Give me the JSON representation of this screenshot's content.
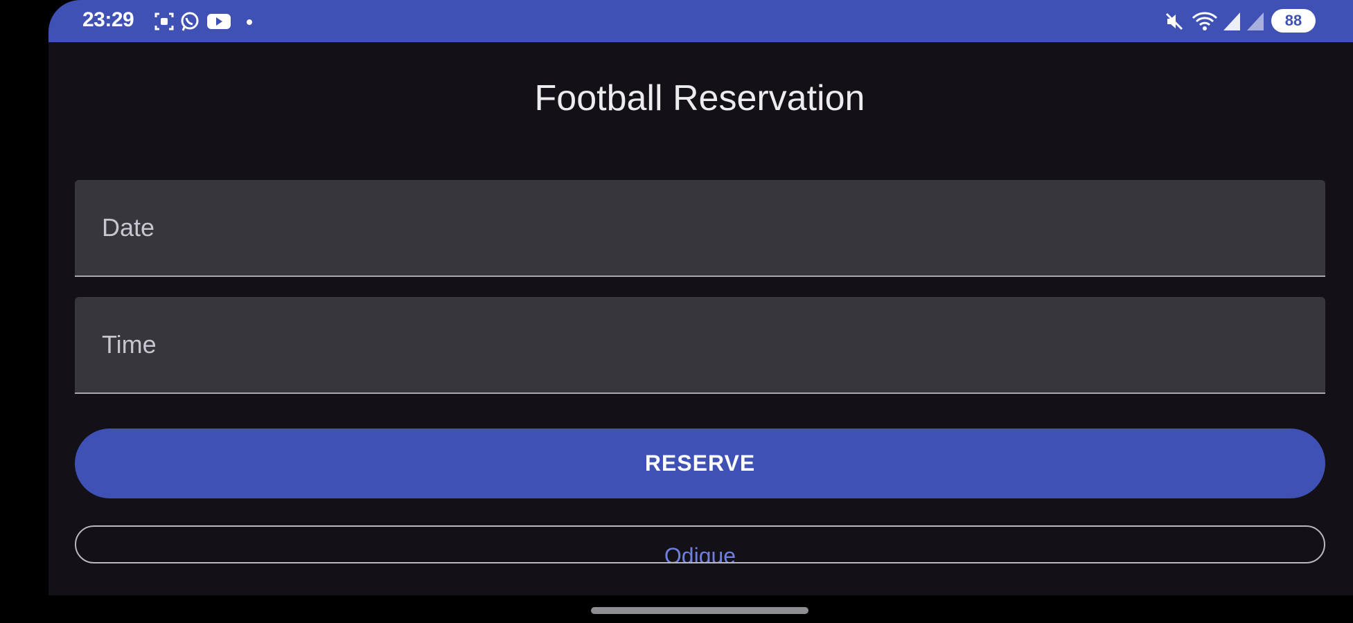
{
  "status_bar": {
    "time": "23:29",
    "battery": "88",
    "left_icons": [
      "screen-record-icon",
      "whatsapp-icon",
      "youtube-icon",
      "notification-dot-icon"
    ],
    "right_icons": [
      "mute-icon",
      "wifi-icon",
      "signal-icon",
      "signal-2-icon"
    ]
  },
  "app": {
    "title": "Football Reservation"
  },
  "form": {
    "date_label": "Date",
    "time_label": "Time",
    "reserve_label": "RESERVE",
    "cancel_label": "Odique"
  },
  "colors": {
    "primary": "#3f51b5",
    "background": "#131117",
    "field": "#37363d"
  }
}
